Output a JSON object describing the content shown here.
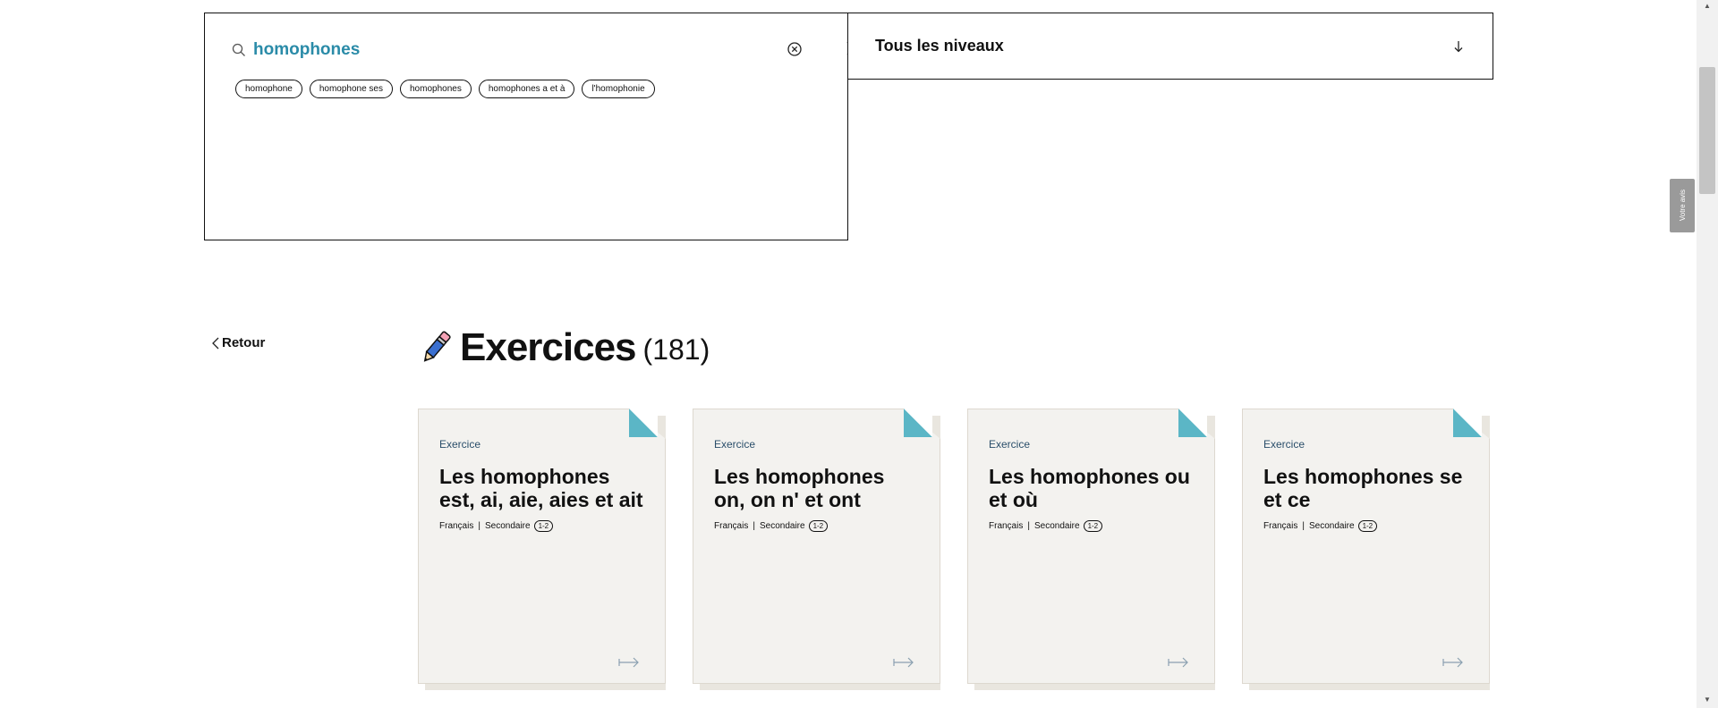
{
  "search": {
    "query": "homophones",
    "suggestions": [
      "homophone",
      "homophone ses",
      "homophones",
      "homophones a et à",
      "l'homophonie"
    ]
  },
  "level_filter": {
    "label": "Tous les niveaux"
  },
  "feedback_tab": {
    "label": "Votre avis"
  },
  "nav": {
    "back_label": "Retour"
  },
  "section": {
    "title": "Exercices",
    "count": "(181)"
  },
  "cards": [
    {
      "type": "Exercice",
      "title": "Les homophones est, ai, aie, aies et ait",
      "subject": "Français",
      "level": "Secondaire",
      "grade": "1-2"
    },
    {
      "type": "Exercice",
      "title": "Les homophones on, on n' et ont",
      "subject": "Français",
      "level": "Secondaire",
      "grade": "1-2"
    },
    {
      "type": "Exercice",
      "title": "Les homophones ou et où",
      "subject": "Français",
      "level": "Secondaire",
      "grade": "1-2"
    },
    {
      "type": "Exercice",
      "title": "Les homophones se et ce",
      "subject": "Français",
      "level": "Secondaire",
      "grade": "1-2"
    }
  ],
  "colors": {
    "accent": "#2a8ba8",
    "fold": "#5bb6c6",
    "card_bg": "#f3f2ef"
  },
  "icons": [
    "search-icon",
    "clear-icon",
    "close-icon",
    "arrow-down-icon",
    "chevron-left-icon",
    "pencil-icon",
    "arrow-right-icon"
  ]
}
